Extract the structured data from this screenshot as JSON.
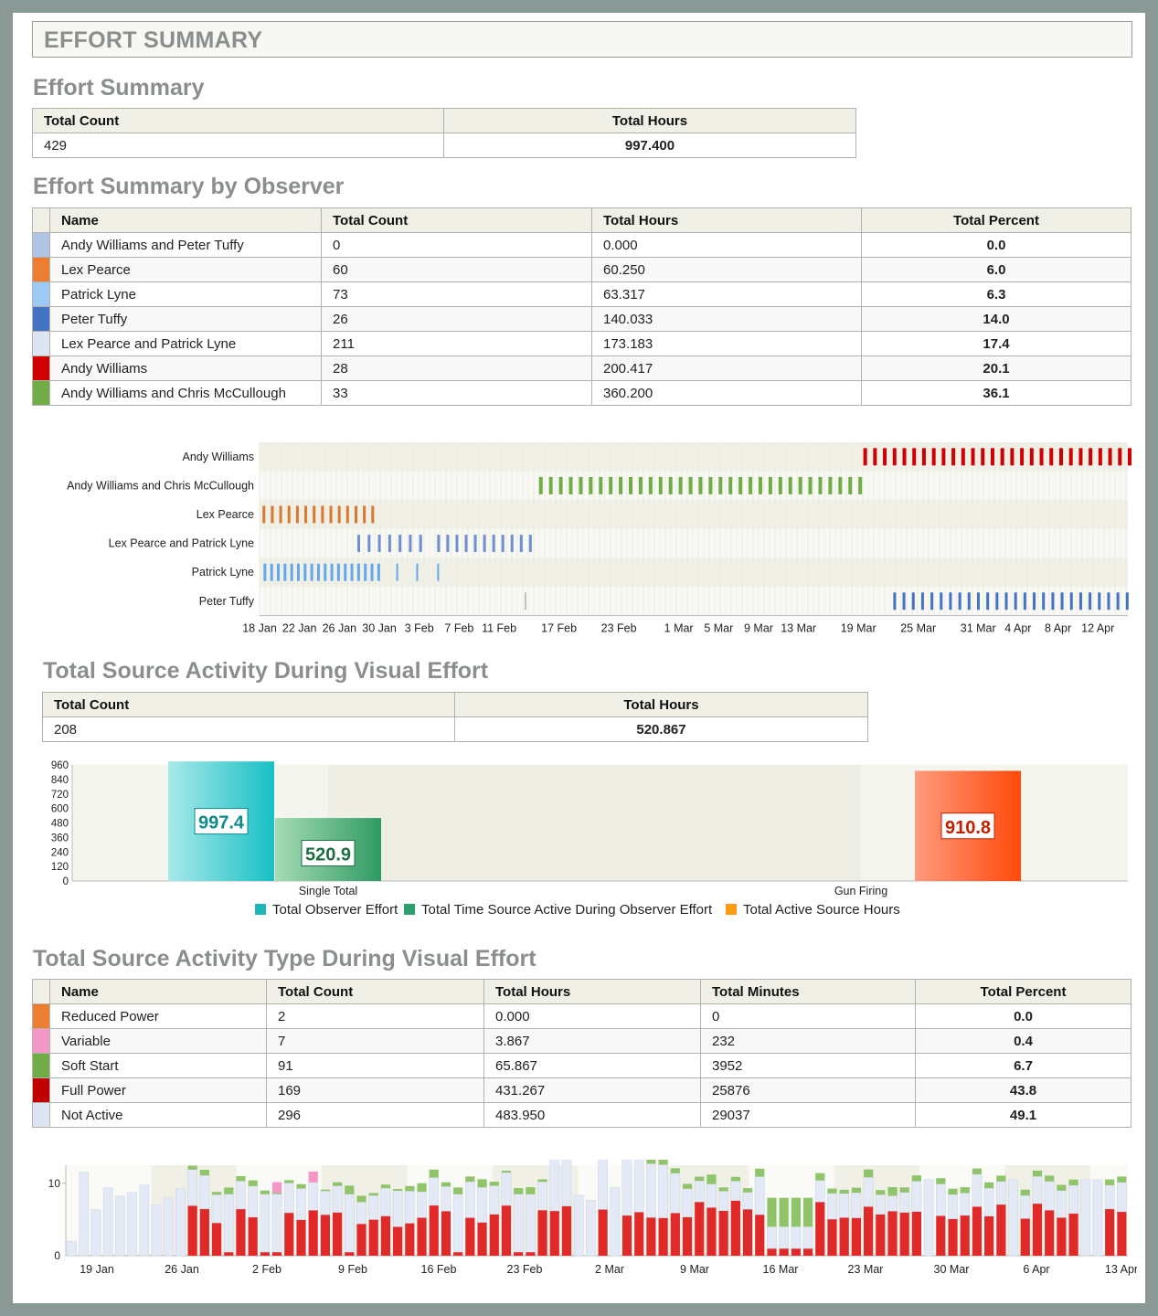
{
  "page_title": "EFFORT SUMMARY",
  "effort_summary": {
    "title": "Effort Summary",
    "headers": [
      "Total Count",
      "Total Hours"
    ],
    "row": [
      "429",
      "997.400"
    ]
  },
  "by_observer": {
    "title": "Effort Summary by Observer",
    "headers": [
      "Name",
      "Total Count",
      "Total Hours",
      "Total Percent"
    ],
    "rows": [
      {
        "color": "#b0c4e6",
        "name": "Andy Williams and Peter Tuffy",
        "count": "0",
        "hours": "0.000",
        "percent": "0.0"
      },
      {
        "color": "#ed7d31",
        "name": "Lex Pearce",
        "count": "60",
        "hours": "60.250",
        "percent": "6.0"
      },
      {
        "color": "#9dc9f5",
        "name": "Patrick Lyne",
        "count": "73",
        "hours": "63.317",
        "percent": "6.3"
      },
      {
        "color": "#4472c4",
        "name": "Peter Tuffy",
        "count": "26",
        "hours": "140.033",
        "percent": "14.0"
      },
      {
        "color": "#dde5f3",
        "name": "Lex Pearce and Patrick Lyne",
        "count": "211",
        "hours": "173.183",
        "percent": "17.4"
      },
      {
        "color": "#d00000",
        "name": "Andy Williams",
        "count": "28",
        "hours": "200.417",
        "percent": "20.1"
      },
      {
        "color": "#70ad47",
        "name": "Andy Williams and Chris McCullough",
        "count": "33",
        "hours": "360.200",
        "percent": "36.1"
      }
    ]
  },
  "source_activity": {
    "title": "Total Source Activity During Visual Effort",
    "headers": [
      "Total Count",
      "Total Hours"
    ],
    "row": [
      "208",
      "520.867"
    ]
  },
  "activity_type": {
    "title": "Total Source Activity Type During Visual Effort",
    "headers": [
      "Name",
      "Total Count",
      "Total Hours",
      "Total Minutes",
      "Total Percent"
    ],
    "rows": [
      {
        "color": "#ed7d31",
        "name": "Reduced Power",
        "count": "2",
        "hours": "0.000",
        "minutes": "0",
        "percent": "0.0"
      },
      {
        "color": "#f497c6",
        "name": "Variable",
        "count": "7",
        "hours": "3.867",
        "minutes": "232",
        "percent": "0.4"
      },
      {
        "color": "#70ad47",
        "name": "Soft Start",
        "count": "91",
        "hours": "65.867",
        "minutes": "3952",
        "percent": "6.7"
      },
      {
        "color": "#c00000",
        "name": "Full Power",
        "count": "169",
        "hours": "431.267",
        "minutes": "25876",
        "percent": "43.8"
      },
      {
        "color": "#dde5f3",
        "name": "Not Active",
        "count": "296",
        "hours": "483.950",
        "minutes": "29037",
        "percent": "49.1"
      }
    ]
  },
  "chart_data": [
    {
      "type": "timeline",
      "categories": [
        "Andy Williams",
        "Andy Williams and Chris McCullough",
        "Lex Pearce",
        "Lex Pearce and Patrick Lyne",
        "Patrick Lyne",
        "Peter Tuffy"
      ],
      "x_ticks": [
        "18 Jan",
        "22 Jan",
        "26 Jan",
        "30 Jan",
        "3 Feb",
        "7 Feb",
        "11 Feb",
        "17 Feb",
        "23 Feb",
        "1 Mar",
        "5 Mar",
        "9 Mar",
        "13 Mar",
        "19 Mar",
        "25 Mar",
        "31 Mar",
        "4 Apr",
        "8 Apr",
        "12 Apr"
      ],
      "series": [
        {
          "color": "#d00000",
          "start": 80.8,
          "end": 85.7,
          "count": 28
        },
        {
          "color": "#70ad47",
          "start": 31.0,
          "end": 36.3,
          "count": 33
        },
        {
          "color": "#ed7d31",
          "start": 0.2,
          "end": 16.6,
          "count": 14
        },
        {
          "color": "#4472c4",
          "start": 15.0,
          "end": 42.0,
          "count": 22
        },
        {
          "color": "#9dc9f5",
          "start": 0.5,
          "end": 26.0,
          "count": 20
        },
        {
          "color": "#4472c4",
          "start": 40.5,
          "end": 86.0,
          "count": 26
        }
      ]
    },
    {
      "type": "bar",
      "categories": [
        "Single Total",
        "Gun Firing"
      ],
      "ylim": [
        0,
        960
      ],
      "yticks": [
        "960",
        "840",
        "720",
        "600",
        "480",
        "360",
        "240",
        "120",
        "0"
      ],
      "series": [
        {
          "name": "Total Observer Effort",
          "color": "#1fb7b7",
          "values": [
            997.4,
            null
          ],
          "label": "997.4"
        },
        {
          "name": "Total Time Source Active During Observer Effort",
          "color": "#2e9e6a",
          "values": [
            520.9,
            null
          ],
          "label": "520.9"
        },
        {
          "name": "Total Active Source Hours",
          "color": "#ff8c1a",
          "values": [
            null,
            910.8
          ],
          "label": "910.8"
        }
      ]
    },
    {
      "type": "bar",
      "stacked": true,
      "yticks": [
        "10",
        "0"
      ],
      "x_ticks": [
        "19 Jan",
        "26 Jan",
        "2 Feb",
        "9 Feb",
        "16 Feb",
        "23 Feb",
        "2 Mar",
        "9 Mar",
        "16 Mar",
        "23 Mar",
        "30 Mar",
        "6 Apr",
        "13 Apr"
      ],
      "series_names": [
        "Not Active",
        "Full Power",
        "Soft Start",
        "Variable",
        "Reduced Power"
      ],
      "colors": {
        "not_active": "#e4eaf5",
        "full_power": "#e02a2a",
        "soft_start": "#8fc46a",
        "variable": "#f497c6"
      }
    }
  ]
}
